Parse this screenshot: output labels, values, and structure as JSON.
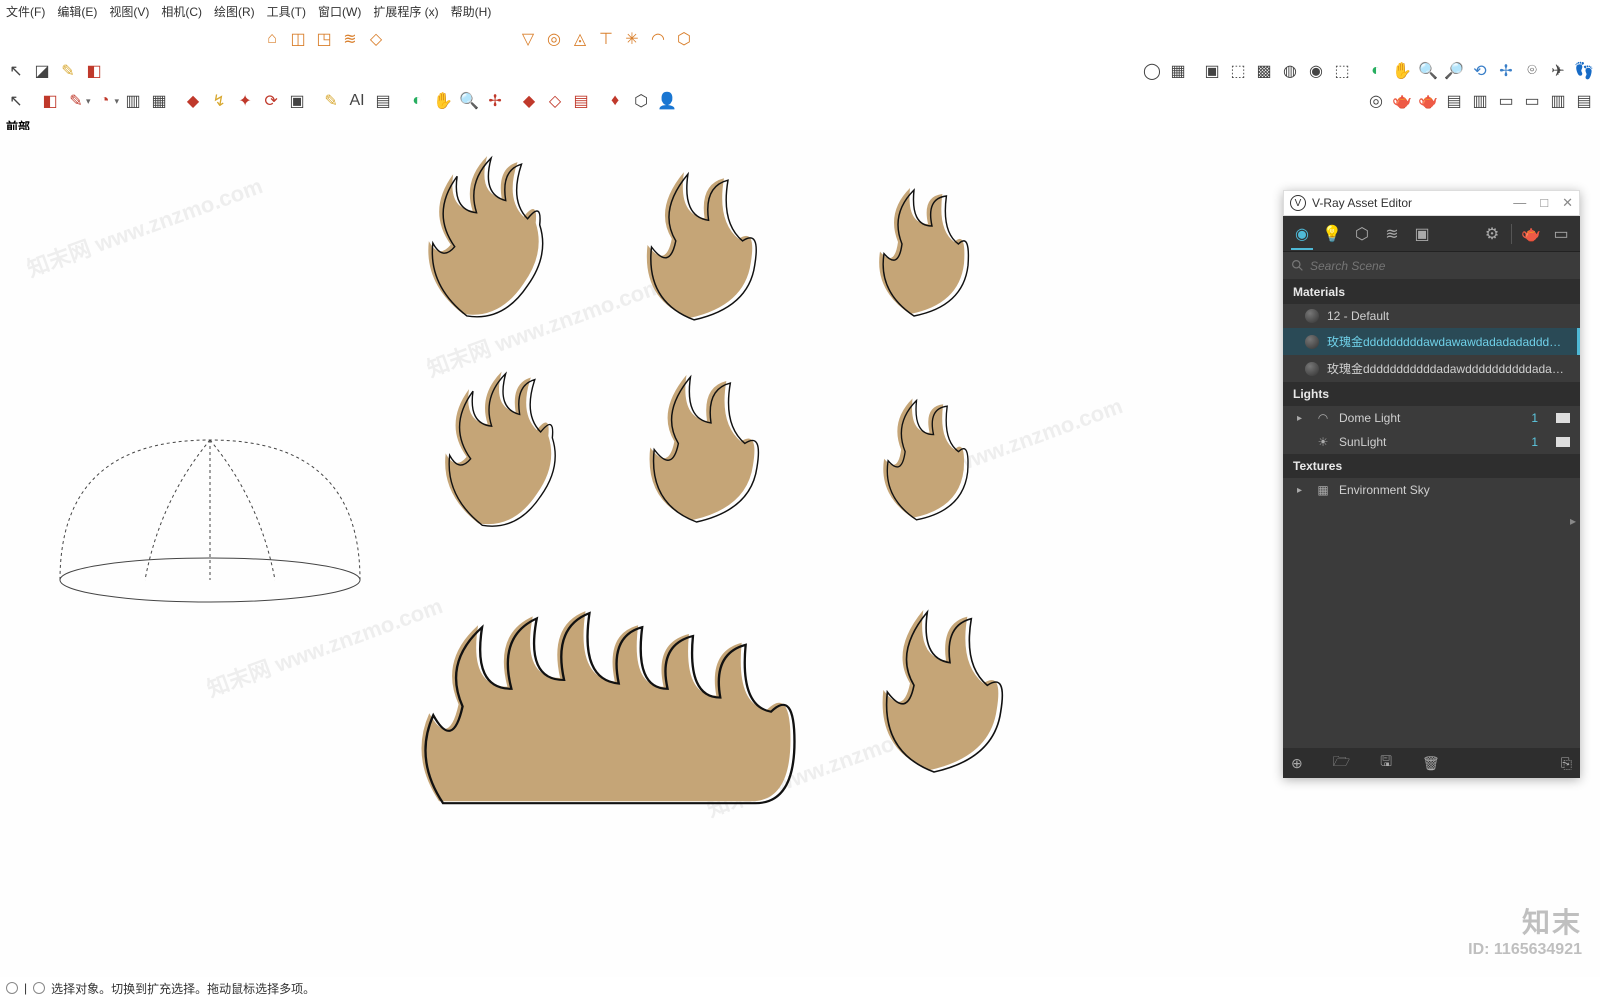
{
  "menu": {
    "file": "文件(F)",
    "edit": "编辑(E)",
    "view": "视图(V)",
    "camera": "相机(C)",
    "draw": "绘图(R)",
    "tools": "工具(T)",
    "window": "窗口(W)",
    "extensions": "扩展程序 (x)",
    "help": "帮助(H)"
  },
  "view_label": "前部",
  "statusbar": {
    "text": "选择对象。切换到扩充选择。拖动鼠标选择多项。"
  },
  "watermark": {
    "brand": "知末",
    "id_label": "ID: 1165634921"
  },
  "vray": {
    "title": "V-Ray Asset Editor",
    "search_placeholder": "Search Scene",
    "sections": {
      "materials": "Materials",
      "lights": "Lights",
      "textures": "Textures"
    },
    "materials": [
      {
        "name": "12 - Default",
        "selected": false
      },
      {
        "name": "玫瑰金dddddddddawdawawdadadadadddddddddddd...",
        "selected": true
      },
      {
        "name": "玫瑰金dddddddddddadawddddddddddadadadadada...",
        "selected": false
      }
    ],
    "lights": [
      {
        "name": "Dome Light",
        "count": "1",
        "expandable": true,
        "icon": "dome"
      },
      {
        "name": "SunLight",
        "count": "1",
        "expandable": false,
        "icon": "sun"
      }
    ],
    "textures": [
      {
        "name": "Environment Sky"
      }
    ],
    "winbtns": {
      "min": "—",
      "max": "□",
      "close": "✕"
    }
  },
  "toolbars": {
    "row1a": [
      "⌂",
      "◫",
      "◳",
      "≋",
      "◇"
    ],
    "row1b": [
      "▽",
      "◎",
      "◬",
      "⊤",
      "✳",
      "◠",
      "⬡"
    ],
    "row2_left": [
      "↖",
      "◪",
      "✎",
      "◧"
    ],
    "row2_right": [
      "◯",
      "▦",
      "▣",
      "⬚",
      "▩",
      "◍",
      "◉",
      "⬚",
      "◐",
      "✋",
      "🔍",
      "🔎",
      "⟲",
      "✢",
      "⌾",
      "✈",
      "👣"
    ],
    "row3_left": [
      "↖",
      "◧",
      "✎",
      "▾",
      "◔",
      "▾",
      "▥",
      "▦",
      "◆",
      "↯",
      "✦",
      "⟳",
      "▣",
      "✎",
      "AI",
      "▤",
      "◐",
      "✋",
      "🔍",
      "✢",
      "◆",
      "◇",
      "▤",
      "♦",
      "⬡",
      "👤"
    ],
    "row3_right": [
      "◎",
      "🫖",
      "🫖",
      "▤",
      "▥",
      "▭",
      "▭",
      "▥",
      "▤"
    ]
  }
}
